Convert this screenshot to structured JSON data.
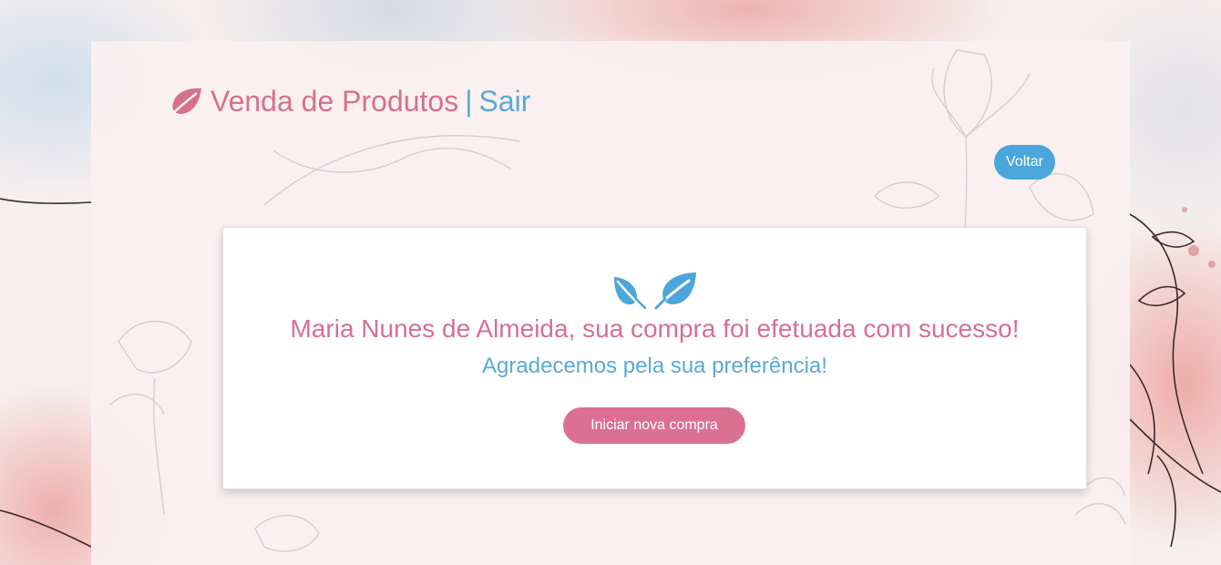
{
  "header": {
    "brand_icon": "leaf-icon",
    "title": "Venda de Produtos",
    "separator": "|",
    "logout_label": "Sair"
  },
  "toolbar": {
    "back_label": "Voltar"
  },
  "confirmation": {
    "icons": [
      "leaf-outline-icon",
      "leaf-filled-icon"
    ],
    "message": "Maria Nunes de Almeida, sua compra foi efetuada com sucesso!",
    "thanks": "Agradecemos pela sua preferência!",
    "new_purchase_label": "Iniciar nova compra"
  },
  "colors": {
    "primary_pink": "#db7093",
    "title_pink": "#d6708f",
    "accent_blue": "#4ba6db",
    "text_blue": "#5aa9d6",
    "card_background": "#ffffff"
  }
}
